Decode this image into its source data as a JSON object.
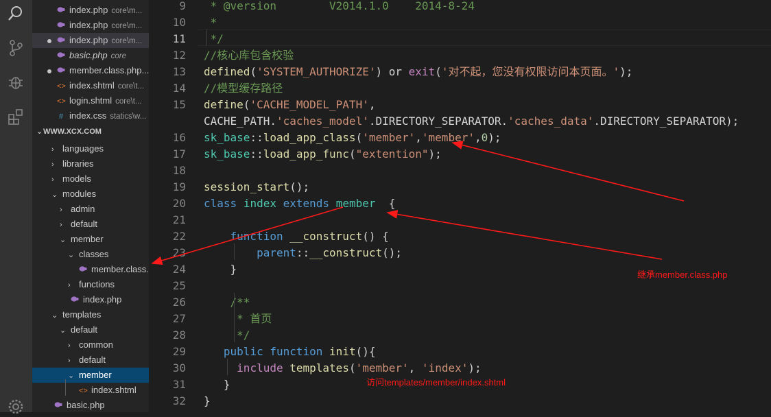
{
  "activity": {
    "icons": [
      "search-icon",
      "source-control-icon",
      "debug-icon",
      "extensions-icon",
      "settings-gear-icon"
    ]
  },
  "sidebar": {
    "open_editors": [
      {
        "name": "index.php",
        "desc": "core\\m...",
        "modified": false,
        "italic": false,
        "type": "php"
      },
      {
        "name": "index.php",
        "desc": "core\\m...",
        "modified": false,
        "italic": false,
        "type": "php"
      },
      {
        "name": "index.php",
        "desc": "core\\m...",
        "modified": true,
        "italic": false,
        "type": "php"
      },
      {
        "name": "basic.php",
        "desc": "core",
        "modified": false,
        "italic": true,
        "type": "php"
      },
      {
        "name": "member.class.php...",
        "desc": "",
        "modified": true,
        "italic": false,
        "type": "php"
      },
      {
        "name": "index.shtml",
        "desc": "core\\t...",
        "modified": false,
        "italic": false,
        "type": "html"
      },
      {
        "name": "login.shtml",
        "desc": "core\\t...",
        "modified": false,
        "italic": false,
        "type": "html"
      },
      {
        "name": "index.css",
        "desc": "statics\\w...",
        "modified": false,
        "italic": false,
        "type": "css"
      }
    ],
    "folder_title": "WWW.XCX.COM",
    "tree": [
      {
        "label": "languages",
        "depth": 1,
        "kind": "folder",
        "open": false
      },
      {
        "label": "libraries",
        "depth": 1,
        "kind": "folder",
        "open": false
      },
      {
        "label": "models",
        "depth": 1,
        "kind": "folder",
        "open": false
      },
      {
        "label": "modules",
        "depth": 1,
        "kind": "folder",
        "open": true
      },
      {
        "label": "admin",
        "depth": 2,
        "kind": "folder",
        "open": false
      },
      {
        "label": "default",
        "depth": 2,
        "kind": "folder",
        "open": false
      },
      {
        "label": "member",
        "depth": 2,
        "kind": "folder",
        "open": true
      },
      {
        "label": "classes",
        "depth": 3,
        "kind": "folder",
        "open": true
      },
      {
        "label": "member.class.php",
        "depth": 4,
        "kind": "php"
      },
      {
        "label": "functions",
        "depth": 3,
        "kind": "folder",
        "open": false
      },
      {
        "label": "index.php",
        "depth": 3,
        "kind": "php"
      },
      {
        "label": "templates",
        "depth": 1,
        "kind": "folder",
        "open": true
      },
      {
        "label": "default",
        "depth": 2,
        "kind": "folder",
        "open": true
      },
      {
        "label": "common",
        "depth": 3,
        "kind": "folder",
        "open": false
      },
      {
        "label": "default",
        "depth": 3,
        "kind": "folder",
        "open": false
      },
      {
        "label": "member",
        "depth": 3,
        "kind": "folder",
        "open": true,
        "selected": true
      },
      {
        "label": "index.shtml",
        "depth": 4,
        "kind": "html"
      },
      {
        "label": "basic.php",
        "depth": 1,
        "kind": "php"
      }
    ]
  },
  "editor": {
    "active_line": "11",
    "lines": [
      {
        "n": "9",
        "tokens": [
          [
            " * @version        V2014.1.0    2014-8-24",
            "com"
          ]
        ]
      },
      {
        "n": "10",
        "tokens": [
          [
            " *",
            "com"
          ]
        ]
      },
      {
        "n": "11",
        "tokens": [
          [
            " */",
            "com"
          ]
        ]
      },
      {
        "n": "12",
        "tokens": [
          [
            "//核心库包含校验",
            "com"
          ]
        ]
      },
      {
        "n": "13",
        "tokens": [
          [
            "defined",
            "fn"
          ],
          [
            "(",
            "op"
          ],
          [
            "'SYSTEM_AUTHORIZE'",
            "str"
          ],
          [
            ") ",
            "op"
          ],
          [
            "or",
            "op"
          ],
          [
            " ",
            "op"
          ],
          [
            "exit",
            "ctl"
          ],
          [
            "(",
            "op"
          ],
          [
            "'对不起，您没有权限访问本页面。'",
            "str"
          ],
          [
            ");",
            "op"
          ]
        ]
      },
      {
        "n": "14",
        "tokens": [
          [
            "//模型缓存路径",
            "com"
          ]
        ]
      },
      {
        "n": "15",
        "tokens": [
          [
            "define",
            "fn"
          ],
          [
            "(",
            "op"
          ],
          [
            "'CACHE_MODEL_PATH'",
            "str"
          ],
          [
            ",",
            "op"
          ]
        ]
      },
      {
        "n": "",
        "tokens": [
          [
            "CACHE_PATH",
            "op"
          ],
          [
            ".",
            "op"
          ],
          [
            "'caches_model'",
            "str"
          ],
          [
            ".",
            "op"
          ],
          [
            "DIRECTORY_SEPARATOR",
            "op"
          ],
          [
            ".",
            "op"
          ],
          [
            "'caches_data'",
            "str"
          ],
          [
            ".",
            "op"
          ],
          [
            "DIRECTORY_SEPARATOR",
            "op"
          ],
          [
            ");",
            "op"
          ]
        ]
      },
      {
        "n": "16",
        "tokens": [
          [
            "sk_base",
            "cls"
          ],
          [
            "::",
            "op"
          ],
          [
            "load_app_class",
            "fn"
          ],
          [
            "(",
            "op"
          ],
          [
            "'member'",
            "str"
          ],
          [
            ",",
            "op"
          ],
          [
            "'member'",
            "str"
          ],
          [
            ",",
            "op"
          ],
          [
            "0",
            "num"
          ],
          [
            ");",
            "op"
          ]
        ]
      },
      {
        "n": "17",
        "tokens": [
          [
            "sk_base",
            "cls"
          ],
          [
            "::",
            "op"
          ],
          [
            "load_app_func",
            "fn"
          ],
          [
            "(",
            "op"
          ],
          [
            "\"extention\"",
            "str"
          ],
          [
            ");",
            "op"
          ]
        ]
      },
      {
        "n": "18",
        "tokens": [
          [
            "",
            "op"
          ]
        ]
      },
      {
        "n": "19",
        "tokens": [
          [
            "session_start",
            "fn"
          ],
          [
            "();",
            "op"
          ]
        ]
      },
      {
        "n": "20",
        "tokens": [
          [
            "class",
            "kw"
          ],
          [
            " ",
            "op"
          ],
          [
            "index",
            "cls"
          ],
          [
            " ",
            "op"
          ],
          [
            "extends",
            "kw"
          ],
          [
            " ",
            "op"
          ],
          [
            "member",
            "cls"
          ],
          [
            "  {",
            "op"
          ]
        ]
      },
      {
        "n": "21",
        "tokens": [
          [
            "",
            "op"
          ]
        ]
      },
      {
        "n": "22",
        "tokens": [
          [
            "    ",
            "op"
          ],
          [
            "function",
            "kw"
          ],
          [
            " ",
            "op"
          ],
          [
            "__construct",
            "fn"
          ],
          [
            "() {",
            "op"
          ]
        ]
      },
      {
        "n": "23",
        "tokens": [
          [
            "        ",
            "op"
          ],
          [
            "parent",
            "kw"
          ],
          [
            "::",
            "op"
          ],
          [
            "__construct",
            "fn"
          ],
          [
            "();",
            "op"
          ]
        ]
      },
      {
        "n": "24",
        "tokens": [
          [
            "    }",
            "op"
          ]
        ]
      },
      {
        "n": "25",
        "tokens": [
          [
            "",
            "op"
          ]
        ]
      },
      {
        "n": "26",
        "tokens": [
          [
            "    /**",
            "com"
          ]
        ]
      },
      {
        "n": "27",
        "tokens": [
          [
            "     * 首页",
            "com"
          ]
        ]
      },
      {
        "n": "28",
        "tokens": [
          [
            "     */",
            "com"
          ]
        ]
      },
      {
        "n": "29",
        "tokens": [
          [
            "   ",
            "op"
          ],
          [
            "public",
            "kw"
          ],
          [
            " ",
            "op"
          ],
          [
            "function",
            "kw"
          ],
          [
            " ",
            "op"
          ],
          [
            "init",
            "fn"
          ],
          [
            "(){",
            "op"
          ]
        ]
      },
      {
        "n": "30",
        "tokens": [
          [
            "     ",
            "op"
          ],
          [
            "include",
            "ctl"
          ],
          [
            " ",
            "op"
          ],
          [
            "templates",
            "fn"
          ],
          [
            "(",
            "op"
          ],
          [
            "'member'",
            "str"
          ],
          [
            ", ",
            "op"
          ],
          [
            "'index'",
            "str"
          ],
          [
            ");",
            "op"
          ]
        ]
      },
      {
        "n": "31",
        "tokens": [
          [
            "   }",
            "op"
          ]
        ]
      },
      {
        "n": "32",
        "tokens": [
          [
            "}",
            "op"
          ]
        ]
      }
    ]
  },
  "annotations": {
    "inherit_note": "继承member.class.php",
    "template_note": "访问templates/member/index.shtml"
  },
  "colors": {
    "arrow": "#ff1a1a",
    "selection": "#094771"
  }
}
